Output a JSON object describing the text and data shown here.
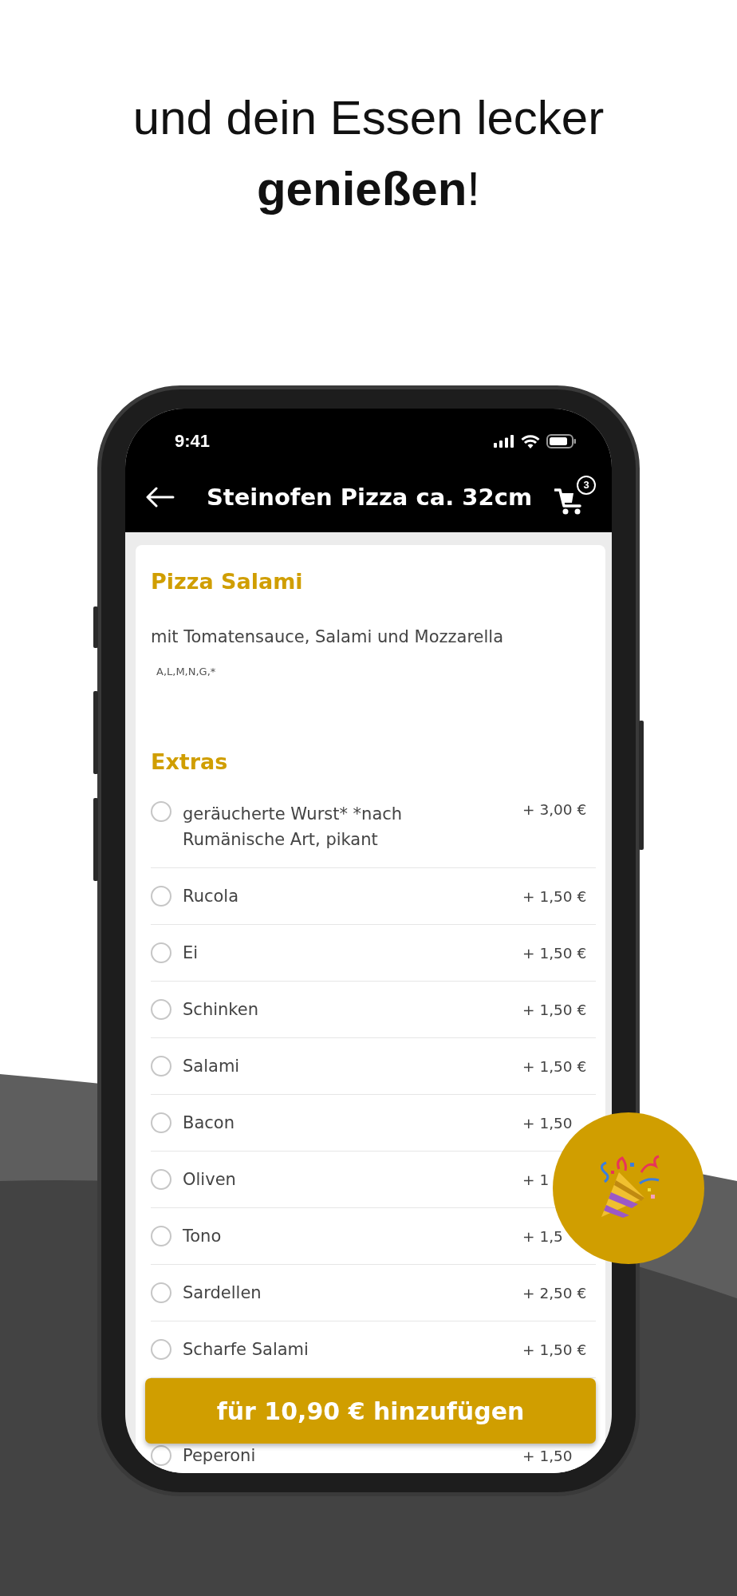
{
  "headline": [
    "und dein Essen lecker",
    "**genießen**!"
  ],
  "status_bar": {
    "time": "9:41"
  },
  "nav": {
    "title": "Steinofen Pizza ca. 32cm",
    "cart_count": "3"
  },
  "product": {
    "name": "Pizza Salami",
    "description": "mit Tomatensauce, Salami und Mozzarella",
    "allergens": "A,L,M,N,G,*"
  },
  "extras": {
    "title": "Extras",
    "items": [
      {
        "name": "geräucherte Wurst* *nach Rumänische Art, pikant",
        "price": "+ 3,00 €",
        "selected": false
      },
      {
        "name": "Rucola",
        "price": "+ 1,50 €",
        "selected": false
      },
      {
        "name": "Ei",
        "price": "+ 1,50 €",
        "selected": false
      },
      {
        "name": "Schinken",
        "price": "+ 1,50 €",
        "selected": false
      },
      {
        "name": "Salami",
        "price": "+ 1,50 €",
        "selected": false
      },
      {
        "name": "Bacon",
        "price": "+ 1,50",
        "selected": false
      },
      {
        "name": "Oliven",
        "price": "+ 1",
        "selected": false
      },
      {
        "name": "Tono",
        "price": "+ 1,5",
        "selected": false
      },
      {
        "name": "Sardellen",
        "price": "+ 2,50 €",
        "selected": false
      },
      {
        "name": "Scharfe Salami",
        "price": "+ 1,50 €",
        "selected": false
      },
      {
        "name": "Peperoni",
        "price": "+ 1,50",
        "selected": false
      }
    ]
  },
  "add_button": {
    "label": "für 10,90 € hinzufügen"
  }
}
